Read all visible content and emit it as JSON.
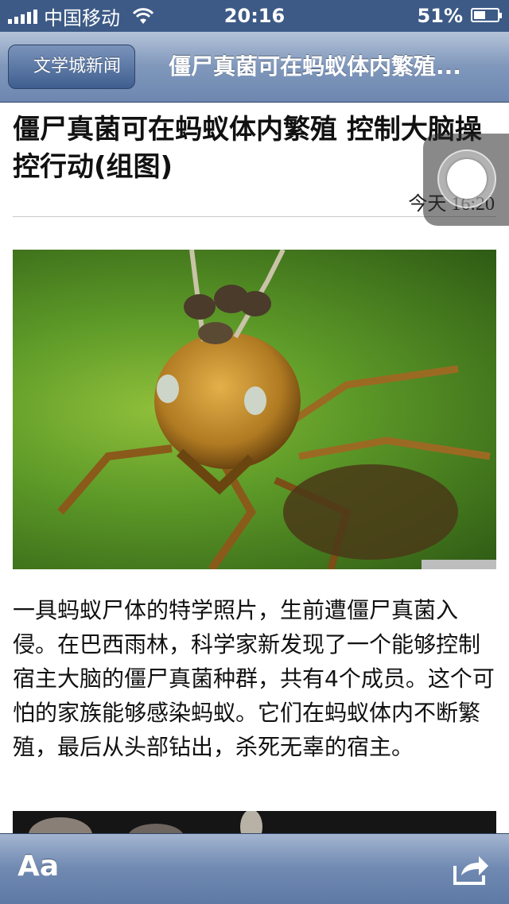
{
  "status_bar": {
    "carrier": "中国移动",
    "time": "20:16",
    "battery_percent": "51%",
    "battery_level": 0.51,
    "icons": [
      "signal-icon",
      "wifi-icon",
      "battery-icon"
    ]
  },
  "nav": {
    "back_label": "文学城新闻",
    "title": "僵尸真菌可在蚂蚁体内繁殖..."
  },
  "article": {
    "title": "僵尸真菌可在蚂蚁体内繁殖 控制大脑操控行动(组图)",
    "time": "今天 16:20",
    "body": "一具蚂蚁尸体的特学照片，生前遭僵尸真菌入侵。在巴西雨林，科学家新发现了一个能够控制宿主大脑的僵尸真菌种群，共有4个成员。这个可怕的家族能够感染蚂蚁。它们在蚂蚁体内不断繁殖，最后从头部钻出，杀死无辜的宿主。"
  },
  "toolbar": {
    "font_label": "Aa",
    "share_icon": "share-icon"
  },
  "overlay": {
    "icon": "assistive-touch-icon"
  }
}
